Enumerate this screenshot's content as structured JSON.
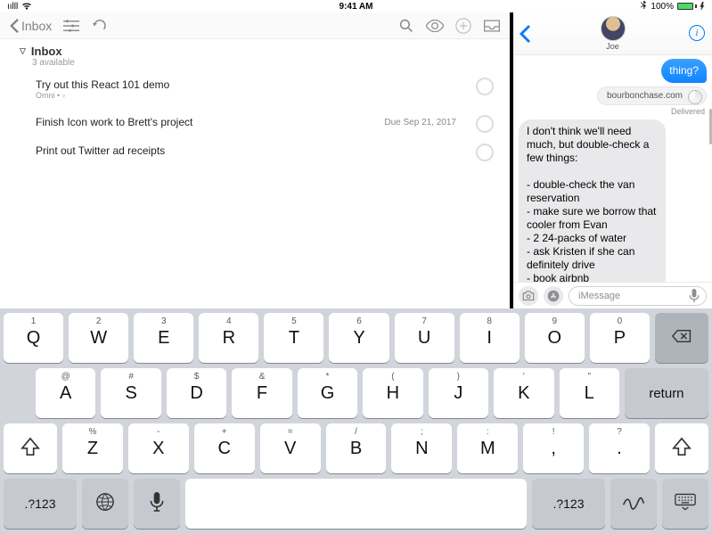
{
  "status": {
    "time": "9:41 AM",
    "signal": "ıılll",
    "wifi": "wifi",
    "network": "",
    "bluetooth": "✱",
    "battery_pct": "100%"
  },
  "omnifocus": {
    "back_label": "Inbox",
    "header": {
      "title": "Inbox",
      "subtitle": "3 available"
    },
    "tasks": [
      {
        "title": "Try out this React 101 demo",
        "sub": "Omni • ▫",
        "due": ""
      },
      {
        "title": "Finish Icon work to Brett's project",
        "sub": "",
        "due": "Due Sep 21, 2017"
      },
      {
        "title": "Print out Twitter ad receipts",
        "sub": "",
        "due": ""
      }
    ]
  },
  "messages": {
    "contact_name": "Joe",
    "outgoing_tail": "thing?",
    "link_host": "bourbonchase.com",
    "delivered_label": "Delivered",
    "incoming": "I don't think we'll need much, but double-check a few things:\n\n- double-check the van reservation\n- make sure we borrow that cooler from Evan\n- 2 24-packs of water\n- ask Kristen if she can definitely drive\n- book airbnb",
    "input_placeholder": "iMessage"
  },
  "keyboard": {
    "row1": [
      {
        "alt": "1",
        "main": "Q"
      },
      {
        "alt": "2",
        "main": "W"
      },
      {
        "alt": "3",
        "main": "E"
      },
      {
        "alt": "4",
        "main": "R"
      },
      {
        "alt": "5",
        "main": "T"
      },
      {
        "alt": "6",
        "main": "Y"
      },
      {
        "alt": "7",
        "main": "U"
      },
      {
        "alt": "8",
        "main": "I"
      },
      {
        "alt": "9",
        "main": "O"
      },
      {
        "alt": "0",
        "main": "P"
      }
    ],
    "row2": [
      {
        "alt": "@",
        "main": "A"
      },
      {
        "alt": "#",
        "main": "S"
      },
      {
        "alt": "$",
        "main": "D"
      },
      {
        "alt": "&",
        "main": "F"
      },
      {
        "alt": "*",
        "main": "G"
      },
      {
        "alt": "(",
        "main": "H"
      },
      {
        "alt": ")",
        "main": "J"
      },
      {
        "alt": "'",
        "main": "K"
      },
      {
        "alt": "\"",
        "main": "L"
      }
    ],
    "return_label": "return",
    "row3": [
      {
        "alt": "%",
        "main": "Z"
      },
      {
        "alt": "-",
        "main": "X"
      },
      {
        "alt": "+",
        "main": "C"
      },
      {
        "alt": "=",
        "main": "V"
      },
      {
        "alt": "/",
        "main": "B"
      },
      {
        "alt": ";",
        "main": "N"
      },
      {
        "alt": ":",
        "main": "M"
      },
      {
        "alt": "!",
        "main": ","
      },
      {
        "alt": "?",
        "main": "."
      }
    ],
    "sym_label": ".?123"
  }
}
